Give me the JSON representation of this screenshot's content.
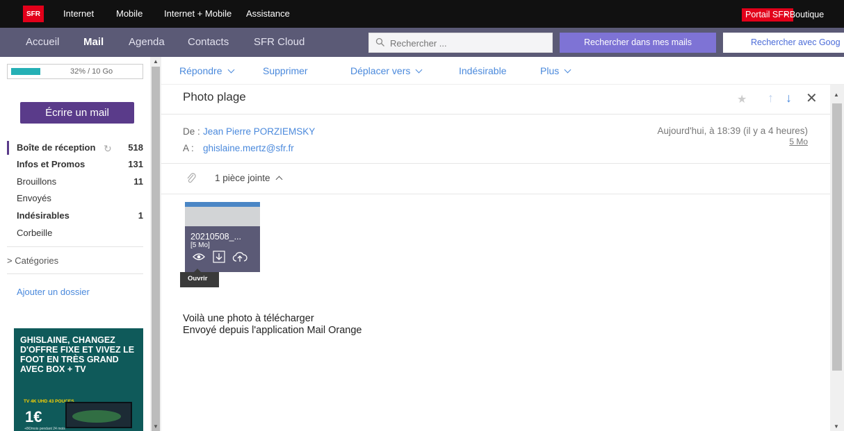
{
  "topbar": {
    "logo": "SFR",
    "links": [
      "Internet",
      "Mobile",
      "Internet + Mobile",
      "Assistance"
    ],
    "portal": "Portail SFR",
    "boutique": "• Boutique"
  },
  "nav": {
    "items": [
      "Accueil",
      "Mail",
      "Agenda",
      "Contacts",
      "SFR Cloud"
    ],
    "active": "Mail",
    "search_placeholder": "Rechercher ...",
    "search_mail_label": "Rechercher dans mes mails",
    "search_google_label": "Rechercher avec Goog"
  },
  "sidebar": {
    "quota": {
      "label": "32% / 10 Go",
      "percent": 32
    },
    "write_label": "Écrire un mail",
    "folders": [
      {
        "label": "Boîte de réception",
        "count": "518"
      },
      {
        "label": "Infos et Promos",
        "count": "131"
      },
      {
        "label": "Brouillons",
        "count": "11"
      },
      {
        "label": "Envoyés",
        "count": ""
      },
      {
        "label": "Indésirables",
        "count": "1"
      },
      {
        "label": "Corbeille",
        "count": ""
      }
    ],
    "categories_label": "> Catégories",
    "add_folder_label": "Ajouter un dossier",
    "ad": {
      "headline": "GHISLAINE, CHANGEZ D'OFFRE FIXE ET VIVEZ LE FOOT EN TRÈS GRAND AVEC BOX + TV",
      "badge": "TV 4K UHD 43 POUCES",
      "price": "1€",
      "small": "+8€/mois pendant 24 mois"
    }
  },
  "toolbar": {
    "reply": "Répondre",
    "delete": "Supprimer",
    "move": "Déplacer vers",
    "spam": "Indésirable",
    "more": "Plus"
  },
  "message": {
    "subject": "Photo plage",
    "from_label": "De :",
    "from": "Jean Pierre PORZIEMSKY",
    "to_label": "A :",
    "to": "ghislaine.mertz@sfr.fr",
    "date": "Aujourd'hui, à 18:39 (il y a 4 heures)",
    "size": "5 Mo",
    "attachments_label": "1 pièce jointe",
    "attachment": {
      "name": "20210508_...",
      "size": "[5 Mo]",
      "tooltip": "Ouvrir"
    },
    "body": [
      "Voilà une photo à télécharger",
      "Envoyé depuis l'application Mail Orange"
    ]
  }
}
